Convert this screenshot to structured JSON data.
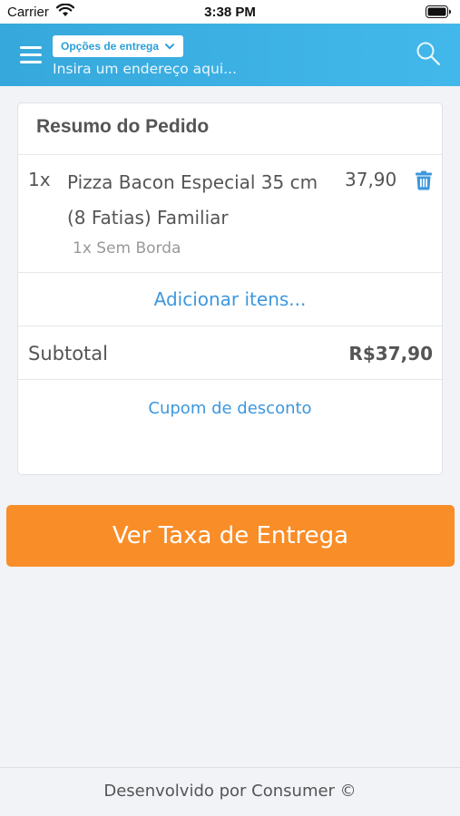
{
  "status_bar": {
    "carrier": "Carrier",
    "time": "3:38 PM",
    "icons": [
      "wifi-icon",
      "battery-icon"
    ]
  },
  "header": {
    "delivery_options_label": "Opções de entrega",
    "address_placeholder": "Insira um endereço aqui...",
    "icons": [
      "menu-icon",
      "chevron-down-icon",
      "search-icon"
    ],
    "background_color": "#3ab0e2"
  },
  "order_summary": {
    "title": "Resumo do Pedido",
    "items": [
      {
        "quantity": "1x",
        "name": "Pizza Bacon Especial 35 cm (8 Fatias) Familiar",
        "price": "37,90",
        "option": "1x Sem Borda",
        "icon": "trash-icon"
      }
    ],
    "add_items_label": "Adicionar itens...",
    "subtotal_label": "Subtotal",
    "subtotal_value": "R$37,90",
    "coupon_label": "Cupom de desconto"
  },
  "cta": {
    "label": "Ver Taxa de Entrega",
    "color": "#f98d28"
  },
  "footer": {
    "text": "Desenvolvido por Consumer ©"
  },
  "colors": {
    "accent_link": "#3d97dd",
    "page_background": "#f2f3f7"
  }
}
